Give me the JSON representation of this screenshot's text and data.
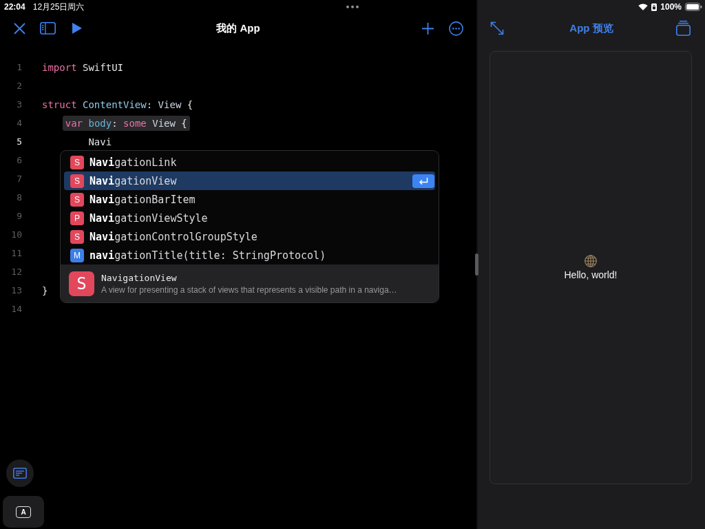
{
  "status_bar": {
    "time": "22:04",
    "date": "12月25日周六",
    "battery": "100%"
  },
  "editor": {
    "title": "我的 App",
    "lines": [
      {
        "number": "1",
        "current": false,
        "highlighted": false,
        "tokens": [
          {
            "text": "import",
            "kind": "keyword"
          },
          {
            "text": " SwiftUI",
            "kind": "plain"
          }
        ]
      },
      {
        "number": "2",
        "current": false,
        "highlighted": false
      },
      {
        "number": "3",
        "current": false,
        "highlighted": false,
        "tokens": [
          {
            "text": "struct",
            "kind": "keyword"
          },
          {
            "text": " ContentView",
            "kind": "declaration"
          },
          {
            "text": ":",
            "kind": "plain"
          },
          {
            "text": " View",
            "kind": "type"
          },
          {
            "text": " {",
            "kind": "plain"
          }
        ]
      },
      {
        "number": "4",
        "current": false,
        "highlighted": true,
        "tokens": [
          {
            "text": "    var",
            "kind": "keyword"
          },
          {
            "text": " body",
            "kind": "property"
          },
          {
            "text": ":",
            "kind": "plain"
          },
          {
            "text": " some",
            "kind": "keyword"
          },
          {
            "text": " View",
            "kind": "type"
          },
          {
            "text": " {",
            "kind": "plain"
          }
        ]
      },
      {
        "number": "5",
        "current": true,
        "highlighted": false,
        "tokens": [
          {
            "text": "        Navi",
            "kind": "plain"
          }
        ]
      },
      {
        "number": "6",
        "current": false,
        "highlighted": false
      },
      {
        "number": "7",
        "current": false,
        "highlighted": false
      },
      {
        "number": "8",
        "current": false,
        "highlighted": false
      },
      {
        "number": "9",
        "current": false,
        "highlighted": false
      },
      {
        "number": "10",
        "current": false,
        "highlighted": false
      },
      {
        "number": "11",
        "current": false,
        "highlighted": false
      },
      {
        "number": "12",
        "current": false,
        "highlighted": false
      },
      {
        "number": "13",
        "current": false,
        "highlighted": false,
        "tokens": [
          {
            "text": "}",
            "kind": "plain"
          }
        ]
      },
      {
        "number": "14",
        "current": false,
        "highlighted": false
      }
    ],
    "completion": {
      "items": [
        {
          "badge": "S",
          "color": "#e2475c",
          "label": "**Navi**gationLink",
          "selected": false
        },
        {
          "badge": "S",
          "color": "#e2475c",
          "label": "**Navi**gationView",
          "selected": true
        },
        {
          "badge": "S",
          "color": "#e2475c",
          "label": "**Navi**gationBarItem",
          "selected": false
        },
        {
          "badge": "P",
          "color": "#e2475c",
          "label": "**Navi**gationViewStyle",
          "selected": false
        },
        {
          "badge": "S",
          "color": "#e2475c",
          "label": "**Navi**gationControlGroupStyle",
          "selected": false
        },
        {
          "badge": "M",
          "color": "#3b7ee8",
          "label": "**navi**gationTitle(title: StringProtocol)",
          "selected": false
        }
      ],
      "detail": {
        "badge": "S",
        "color": "#e2475c",
        "name": "NavigationView",
        "description": "A view for presenting a stack of views that represents a visible path in a naviga…"
      }
    },
    "keyboard_button": {
      "label": "A"
    }
  },
  "preview": {
    "title": "App 预览",
    "text": "Hello, world!"
  }
}
